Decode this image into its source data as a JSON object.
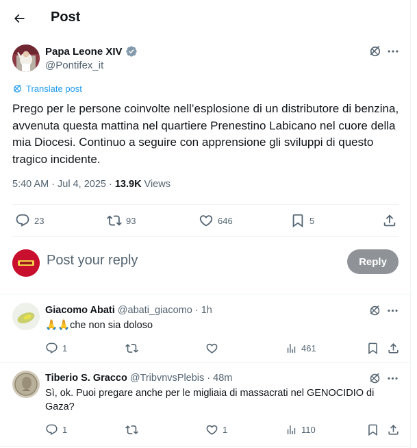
{
  "header": {
    "title": "Post"
  },
  "post": {
    "author_name": "Papa Leone XIV",
    "author_handle": "@Pontifex_it",
    "translate_label": "Translate post",
    "text": "Prego per le persone coinvolte nell’esplosione di un distributore di benzina, avvenuta questa mattina nel quartiere Prenestino Labicano nel cuore della mia Diocesi. Continuo a seguire con apprensione gli sviluppi di questo tragico incidente.",
    "time": "5:40 AM",
    "date": "Jul 4, 2025",
    "views_count": "13.9K",
    "views_label": "Views",
    "replies": "23",
    "reposts": "93",
    "likes": "646",
    "bookmarks": "5"
  },
  "composer": {
    "placeholder": "Post your reply",
    "reply_button": "Reply"
  },
  "comments": [
    {
      "name": "Giacomo Abati",
      "handle": "@abati_giacomo",
      "time": "1h",
      "text": "🙏🙏che non sia doloso",
      "replies": "1",
      "reposts": "",
      "likes": "",
      "views": "461"
    },
    {
      "name": "Tiberio S. Gracco",
      "handle": "@TribvnvsPlebis",
      "time": "48m",
      "text": "Sì, ok. Puoi pregare anche per le migliaia di massacrati nel GENOCIDIO di Gaza?",
      "replies": "1",
      "reposts": "",
      "likes": "1",
      "views": "110"
    }
  ],
  "icons": {
    "back": "arrow-left-icon",
    "verified": "verified-badge-icon",
    "grok": "grok-icon",
    "more": "more-horizontal-icon",
    "translate": "translate-icon",
    "reply": "reply-icon",
    "repost": "repost-icon",
    "like": "like-icon",
    "bookmark": "bookmark-icon",
    "share": "share-icon",
    "views": "views-icon"
  },
  "colors": {
    "accent": "#1d9bf0",
    "verified": "#829aab",
    "secondary_text": "#536471",
    "reply_button_bg": "#8f9397"
  }
}
